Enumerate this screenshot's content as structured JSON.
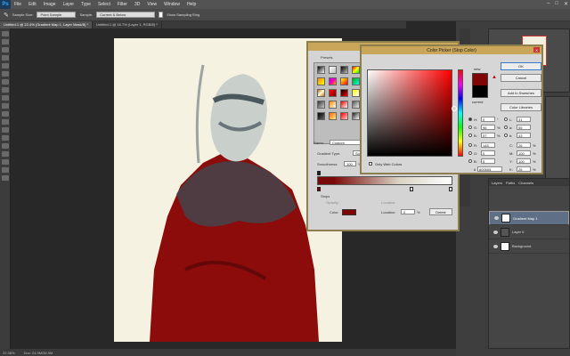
{
  "app": {
    "logo": "Ps"
  },
  "menu": [
    "File",
    "Edit",
    "Image",
    "Layer",
    "Type",
    "Select",
    "Filter",
    "3D",
    "View",
    "Window",
    "Help"
  ],
  "options": {
    "sample_size_label": "Sample Size:",
    "sample_size": "Point Sample",
    "sample_label": "Sample:",
    "sample": "Current & Below",
    "show_ring": "Show Sampling Ring"
  },
  "tabs": [
    "Untitled-1 @ 22.4% (Gradient Map 1, Layer Mask/8) *",
    "Untitled-1 @ 16.7% (Layer 1, RGB/8) *"
  ],
  "status": {
    "zoom": "22.38%",
    "doc": "Doc: 24.9M/38.9M"
  },
  "layers": [
    {
      "name": "Gradient Map 1",
      "selected": true
    },
    {
      "name": "Layer 0",
      "selected": false
    },
    {
      "name": "Background",
      "selected": false
    }
  ],
  "layers_panel": {
    "tabs": [
      "Layers",
      "Paths",
      "Channels"
    ]
  },
  "gradient_editor": {
    "title": "Gradient Editor",
    "presets_label": "Presets",
    "name_label": "Name:",
    "name_value": "Custom",
    "type_label": "Gradient Type:",
    "type_value": "Solid",
    "smooth_label": "Smoothness:",
    "smooth_value": "100",
    "pct": "%",
    "stops_label": "Stops",
    "opacity_label": "Opacity:",
    "location_label": "Location:",
    "color_label": "Color:",
    "location_value": "0",
    "delete_label": "Delete"
  },
  "color_picker": {
    "title": "Color Picker (Stop Color)",
    "new_label": "new",
    "current_label": "current",
    "ok": "OK",
    "cancel": "Cancel",
    "add_swatches": "Add to Swatches",
    "libraries": "Color Libraries",
    "web_only": "Only Web Colors",
    "hex_prefix": "#",
    "hex": "800505",
    "hsb": [
      {
        "k": "H:",
        "v": "0",
        "u": "°"
      },
      {
        "k": "S:",
        "v": "96",
        "u": "%"
      },
      {
        "k": "B:",
        "v": "57",
        "u": "%"
      }
    ],
    "rgb": [
      {
        "k": "R:",
        "v": "145",
        "u": ""
      },
      {
        "k": "G:",
        "v": "0",
        "u": ""
      },
      {
        "k": "B:",
        "v": "5",
        "u": ""
      }
    ],
    "lab": [
      {
        "k": "L:",
        "v": "31",
        "u": ""
      },
      {
        "k": "a:",
        "v": "55",
        "u": ""
      },
      {
        "k": "b:",
        "v": "43",
        "u": ""
      }
    ],
    "cmyk": [
      {
        "k": "C:",
        "v": "26",
        "u": "%"
      },
      {
        "k": "M:",
        "v": "100",
        "u": "%"
      },
      {
        "k": "Y:",
        "v": "100",
        "u": "%"
      },
      {
        "k": "K:",
        "v": "26",
        "u": "%"
      }
    ],
    "new_color": "#800505",
    "current_color": "#000000"
  },
  "colors": {
    "accent_red": "#800505",
    "dialog_border": "#8e7f4e"
  }
}
